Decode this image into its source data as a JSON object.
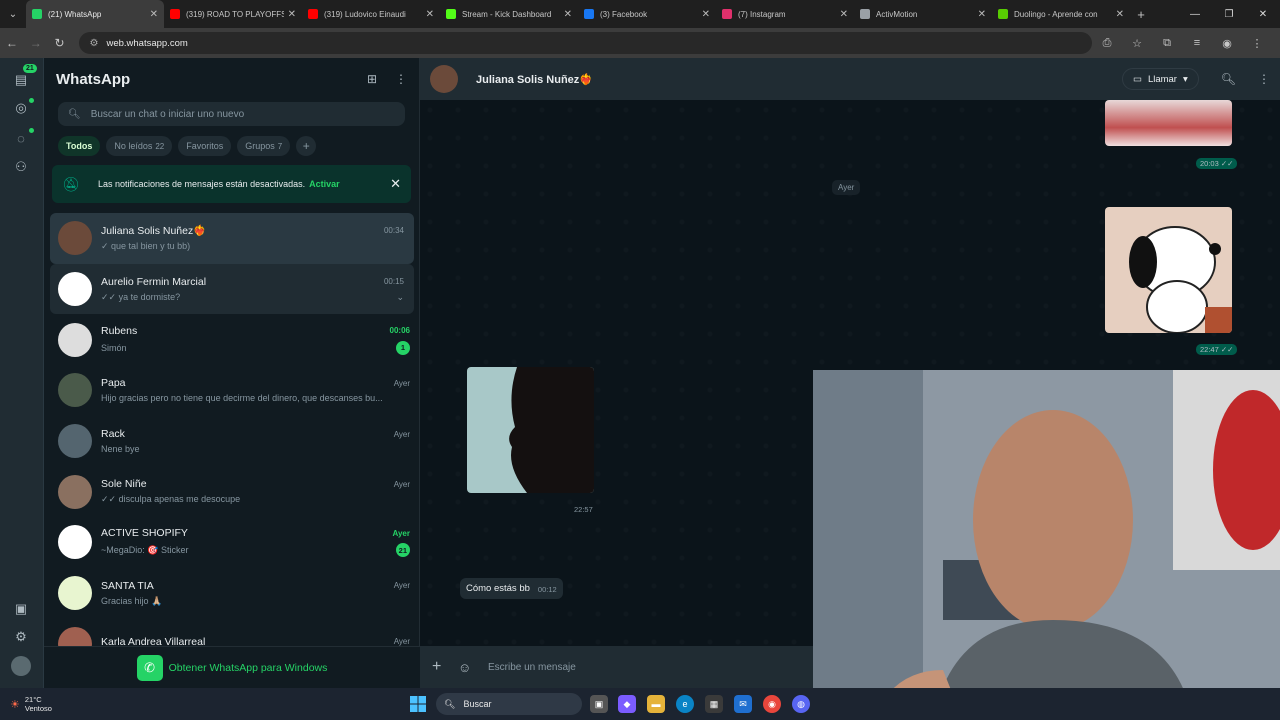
{
  "browser": {
    "tabs": [
      {
        "title": "(21) WhatsApp",
        "color": "#25d366",
        "active": true
      },
      {
        "title": "(319) ROAD TO PLAYOFFS",
        "color": "#ff0000"
      },
      {
        "title": "(319) Ludovico Einaudi",
        "color": "#ff0000"
      },
      {
        "title": "Stream - Kick Dashboard",
        "color": "#53fc18"
      },
      {
        "title": "(3) Facebook",
        "color": "#1877f2"
      },
      {
        "title": "(7) Instagram",
        "color": "#e1306c"
      },
      {
        "title": "ActivMotion",
        "color": "#9aa0a6"
      },
      {
        "title": "Duolingo - Aprende con",
        "color": "#58cc02"
      }
    ],
    "url": "web.whatsapp.com"
  },
  "rail": {
    "badge": "21"
  },
  "sidebar": {
    "title": "WhatsApp",
    "search_placeholder": "Buscar un chat o iniciar uno nuevo",
    "filters": [
      {
        "label": "Todos"
      },
      {
        "label": "No leídos",
        "count": "22"
      },
      {
        "label": "Favoritos"
      },
      {
        "label": "Grupos",
        "count": "7"
      }
    ],
    "notification": {
      "text": "Las notificaciones de mensajes están desactivadas.",
      "action": "Activar"
    },
    "chats": [
      {
        "name": "Juliana Solis Nuñez❤️‍🔥",
        "time": "00:34",
        "msg": "✓ que tal bien y tu bb)",
        "avatar": "#6b4a3a"
      },
      {
        "name": "Aurelio Fermin Marcial",
        "time": "00:15",
        "msg": "✓✓ ya te dormiste?",
        "avatar": "#ffffff"
      },
      {
        "name": "Rubens",
        "time": "00:06",
        "msg": "Simón",
        "unread": "1",
        "avatar": "#dddddd"
      },
      {
        "name": "Papa",
        "time": "Ayer",
        "msg": "Hijo gracias pero no tiene que decirme del dinero, que descanses bu...",
        "avatar": "#4a5a4a"
      },
      {
        "name": "Rack",
        "time": "Ayer",
        "msg": "Nene bye",
        "avatar": "#54656f"
      },
      {
        "name": "Sole Niñe",
        "time": "Ayer",
        "msg": "✓✓ disculpa apenas me desocupe",
        "avatar": "#8a7060"
      },
      {
        "name": "ACTIVE SHOPIFY",
        "time": "Ayer",
        "msg": "~MegaDio: 🎯 Sticker",
        "unread": "21",
        "avatar": "#ffffff"
      },
      {
        "name": "SANTA TIA",
        "time": "Ayer",
        "msg": "Gracias hijo 🙏🏼",
        "avatar": "#e8f5d0"
      },
      {
        "name": "Karla Andrea Villarreal",
        "time": "Ayer",
        "msg": "",
        "avatar": "#a06050"
      }
    ],
    "get_app": "Obtener WhatsApp para Windows"
  },
  "conversation": {
    "contact": "Juliana Solis Nuñez❤️‍🔥",
    "call_label": "Llamar",
    "day_divider": "Ayer",
    "times": {
      "img1": "20:03 ✓✓",
      "img2": "22:47 ✓✓",
      "img3": "22:57"
    },
    "incoming_text": "Cómo estás bb",
    "incoming_time": "00:12",
    "composer_placeholder": "Escribe un mensaje"
  },
  "taskbar": {
    "temp": "21°C",
    "weather": "Ventoso",
    "search": "Buscar"
  }
}
